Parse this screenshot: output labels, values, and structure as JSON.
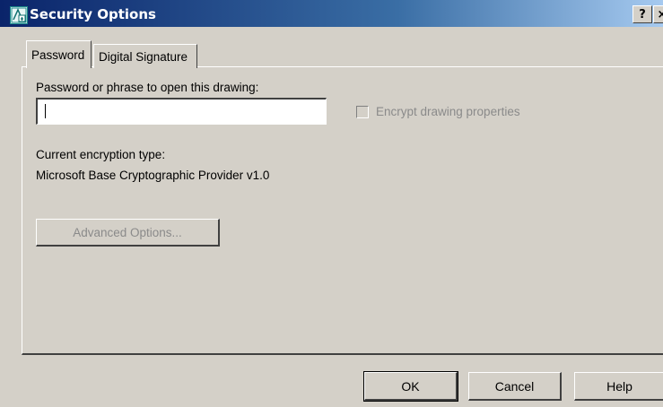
{
  "window": {
    "title": "Security Options",
    "help_glyph": "?",
    "close_glyph": "×"
  },
  "tabs": [
    {
      "label": "Password",
      "selected": true
    },
    {
      "label": "Digital Signature",
      "selected": false
    }
  ],
  "password": {
    "label": "Password or phrase to open this drawing:",
    "value": "",
    "encrypt_label": "Encrypt drawing properties",
    "encrypt_checked": false,
    "encrypt_enabled": false
  },
  "encryption": {
    "label": "Current encryption type:",
    "value": "Microsoft Base Cryptographic Provider v1.0"
  },
  "advanced_button": "Advanced Options...",
  "buttons": {
    "ok": "OK",
    "cancel": "Cancel",
    "help": "Help"
  },
  "icons": {
    "app": "autocad-app-icon"
  }
}
